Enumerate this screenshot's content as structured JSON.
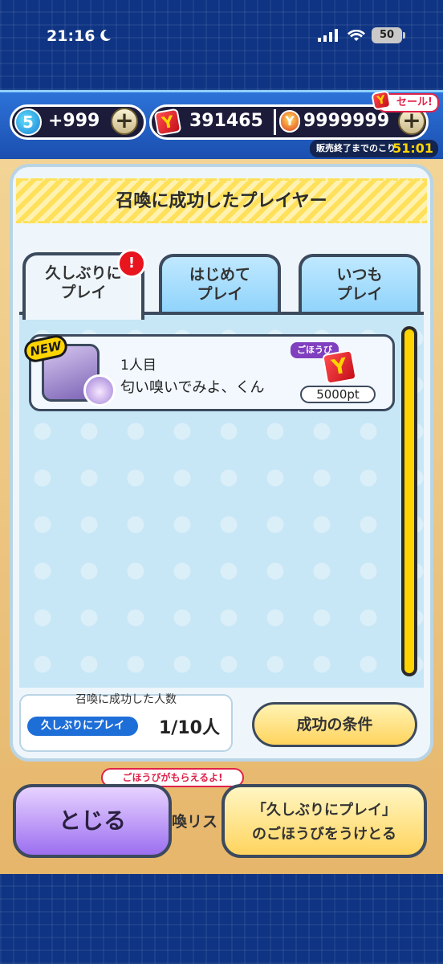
{
  "status_bar": {
    "time": "21:16",
    "battery": "50"
  },
  "currency": {
    "stamina_level": "5",
    "stamina_value": "+999",
    "ymoney_value": "391465",
    "gem_value": "9999999",
    "sale_label": "セール!",
    "timer_label": "販売終了までのこり",
    "timer_value": "51:01"
  },
  "modal": {
    "title": "召喚に成功したプレイヤー",
    "tabs": [
      {
        "label": "久しぶりに\nプレイ"
      },
      {
        "label": "はじめて\nプレイ"
      },
      {
        "label": "いつも\nプレイ"
      }
    ],
    "tab_alert": "!",
    "list": [
      {
        "badge": "NEW",
        "rank": "1人目",
        "name": "匂い嗅いでみよ、くん",
        "reward_tag": "ごほうび",
        "reward_amount": "5000pt"
      }
    ],
    "summary": {
      "title": "召喚に成功した人数",
      "chip": "久しぶりにプレイ",
      "count": "1/10人"
    },
    "conditions_button": "成功の条件"
  },
  "behind": {
    "banner": "ごほうびがもらえるよ!",
    "label": "喚リス"
  },
  "buttons": {
    "close": "とじる",
    "claim": "「久しぶりにプレイ」\nのごほうびをうけとる"
  },
  "colors": {
    "accent_yellow": "#ffd400",
    "frame_dark": "#3c4a5e",
    "panel_blue": "#c7e6f6",
    "alert_red": "#e8141e"
  }
}
